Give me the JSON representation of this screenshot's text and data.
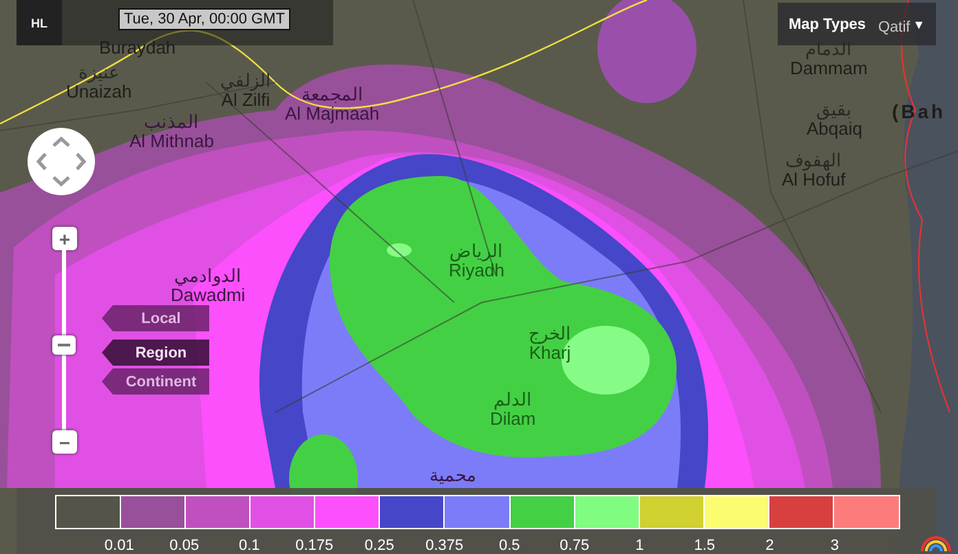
{
  "header": {
    "logo": {
      "letters": [
        "H",
        "L"
      ]
    },
    "timestamp": "Tue, 30 Apr, 00:00 GMT"
  },
  "map_types": {
    "label": "Map Types",
    "caret": "▼"
  },
  "zoom": {
    "zoom_in": "+",
    "zoom_out": "−",
    "level": 0.47
  },
  "scale_buttons": [
    {
      "label": "Local",
      "selected": false
    },
    {
      "label": "Region",
      "selected": true
    },
    {
      "label": "Continent",
      "selected": false
    }
  ],
  "places": [
    {
      "name": "Buraydah"
    },
    {
      "name_ar": "عنيزة",
      "name": "Unaizah"
    },
    {
      "name_ar": "الزلفي",
      "name": "Al Zilfi"
    },
    {
      "name_ar": "المذنب",
      "name": "Al Mithnab"
    },
    {
      "name_ar": "المجمعة",
      "name": "Al Majmaah"
    },
    {
      "name_ar": "الرياض",
      "name": "Riyadh"
    },
    {
      "name_ar": "الدوادمي",
      "name": "Dawadmi"
    },
    {
      "name_ar": "الخرج",
      "name": "Kharj"
    },
    {
      "name_ar": "الدلم",
      "name": "Dilam"
    },
    {
      "name_ar": "محمية"
    },
    {
      "name": "Qatif"
    },
    {
      "name_ar": "الدمام",
      "name": "Dammam"
    },
    {
      "name_ar": "بقيق",
      "name": "Abqaiq"
    },
    {
      "name_ar": "الهفوف",
      "name": "Al Hofuf"
    },
    {
      "name": "(Bah"
    }
  ],
  "legend": {
    "swatches": [
      {
        "color": "#545448"
      },
      {
        "color": "#98509a"
      },
      {
        "color": "#c050c0"
      },
      {
        "color": "#e050e4"
      },
      {
        "color": "#fc50fc"
      },
      {
        "color": "#4646c8"
      },
      {
        "color": "#7c7cf8"
      },
      {
        "color": "#44d044"
      },
      {
        "color": "#80fc80"
      },
      {
        "color": "#d0d030"
      },
      {
        "color": "#fcfc70"
      },
      {
        "color": "#d84040"
      },
      {
        "color": "#fc7c7c"
      }
    ],
    "labels": [
      "0.01",
      "0.05",
      "0.1",
      "0.175",
      "0.25",
      "0.375",
      "0.5",
      "0.75",
      "1",
      "1.5",
      "2",
      "3"
    ]
  }
}
